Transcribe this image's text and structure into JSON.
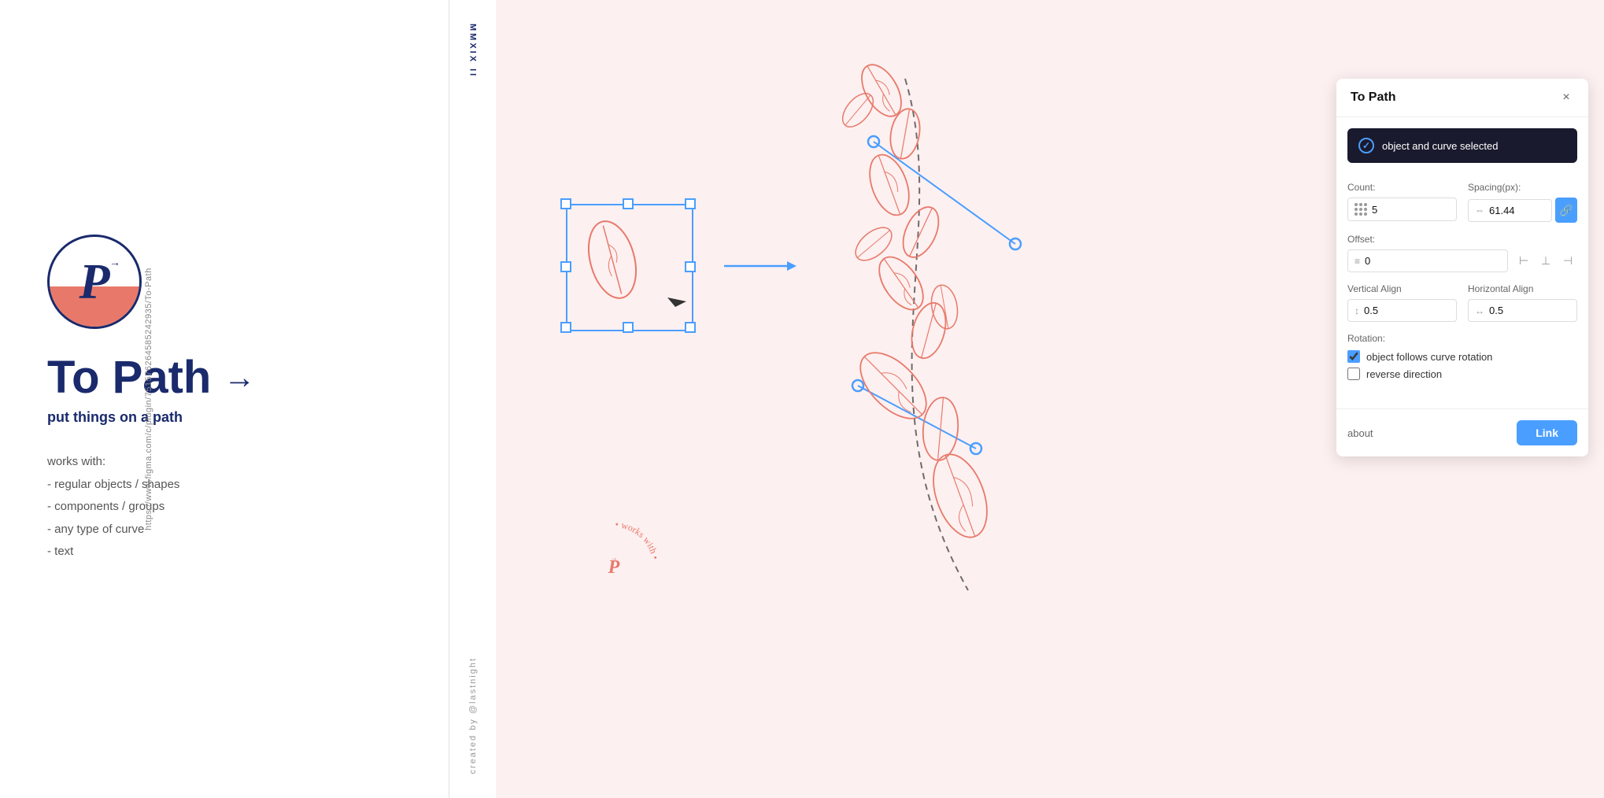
{
  "left_panel": {
    "url": "https://www.figma.com/c/plugin/751576264585242935/To-Path",
    "logo_letter": "P",
    "title": "To Path",
    "title_arrow": "→",
    "subtitle": "put things on a path",
    "works_with_title": "works with:",
    "works_with_items": [
      "- regular objects / shapes",
      "- components / groups",
      "- any type of curve",
      "- text"
    ]
  },
  "middle_divider": {
    "top_text": "MMXIX II",
    "bottom_text": "created by @lastnight"
  },
  "plugin_panel": {
    "title": "To Path",
    "close_label": "×",
    "status": {
      "text": "object and curve selected",
      "icon": "check-circle"
    },
    "count_label": "Count:",
    "count_value": "5",
    "spacing_label": "Spacing(px):",
    "spacing_value": "61.44",
    "offset_label": "Offset:",
    "offset_value": "0",
    "vertical_align_label": "Vertical Align",
    "vertical_align_value": "0.5",
    "horizontal_align_label": "Horizontal Align",
    "horizontal_align_value": "0.5",
    "rotation_label": "Rotation:",
    "follows_curve_label": "object follows curve rotation",
    "reverse_direction_label": "reverse direction",
    "about_label": "about",
    "link_button_label": "Link"
  }
}
